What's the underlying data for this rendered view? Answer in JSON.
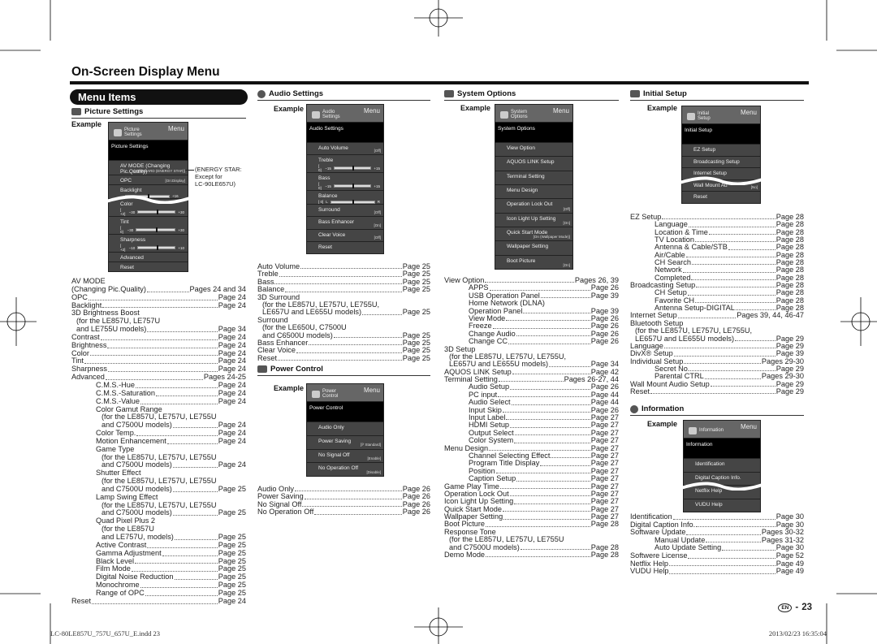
{
  "page_title": "On-Screen Display Menu",
  "menu_items_label": "Menu Items",
  "example_label": "Example",
  "sections": {
    "picture": "Picture Settings",
    "audio": "Audio Settings",
    "power": "Power Control",
    "system": "System Options",
    "initial": "Initial Setup",
    "info": "Information"
  },
  "energy_note": [
    "(ENERGY STAR:",
    "Except for",
    "LC-90LE657U)"
  ],
  "menus": [
    {
      "id": "picture",
      "header": [
        "Picture",
        "Settings"
      ],
      "menu": "Menu",
      "band": "Picture Settings",
      "wave_after": 2,
      "rows": [
        {
          "label": "AV MODE (Changing Pic.Quality)",
          "value": "[STANDARD (ENERGY STAR)]"
        },
        {
          "label": "OPC",
          "value": "[On:Display]"
        },
        {
          "label": "Backlight",
          "slider": {
            "val": "",
            "min": "",
            "max": "+16"
          }
        },
        {
          "label": "Color",
          "slider": {
            "val": "[ +2]",
            "min": "−30",
            "max": "+30"
          }
        },
        {
          "label": "Tint",
          "slider": {
            "val": "[ 0]",
            "min": "−30",
            "max": "+30"
          }
        },
        {
          "label": "Sharpness",
          "slider": {
            "val": "[ +2]",
            "min": "−10",
            "max": "+10"
          }
        },
        {
          "label": "Advanced"
        },
        {
          "label": "Reset"
        }
      ]
    },
    {
      "id": "audio",
      "header": [
        "Audio",
        "Settings"
      ],
      "menu": "Menu",
      "band": "Audio Settings",
      "rows": [
        {
          "label": "Auto Volume",
          "value": "[Off]"
        },
        {
          "label": "Treble",
          "slider": {
            "val": "[ 0]",
            "min": "−15",
            "max": "+15"
          }
        },
        {
          "label": "Bass",
          "slider": {
            "val": "[ 0]",
            "min": "−15",
            "max": "+15"
          }
        },
        {
          "label": "Balance",
          "slider": {
            "val": "[ 0]",
            "min": "L",
            "max": "R"
          }
        },
        {
          "label": "Surround",
          "value": "[Off]"
        },
        {
          "label": "Bass Enhancer",
          "value": "[On]"
        },
        {
          "label": "Clear Voice",
          "value": "[Off]"
        },
        {
          "label": "Reset"
        }
      ]
    },
    {
      "id": "power",
      "header": [
        "Power",
        "Control"
      ],
      "menu": "Menu",
      "band": "Power Control",
      "rows": [
        {
          "label": "Audio Only"
        },
        {
          "label": "Power Saving",
          "value": "[ℙ Standard]"
        },
        {
          "label": "No Signal Off",
          "value": "[Enable]"
        },
        {
          "label": "No Operation Off",
          "value": "[Disable]"
        }
      ]
    },
    {
      "id": "system",
      "header": [
        "System",
        "Options"
      ],
      "menu": "Menu",
      "band": "System Options",
      "rows": [
        {
          "label": "View Option"
        },
        {
          "label": "AQUOS LINK Setup"
        },
        {
          "label": "Terminal Setting"
        },
        {
          "label": "Menu Design"
        },
        {
          "label": "Operation Lock Out",
          "value": "[Off]"
        },
        {
          "label": "Icon Light Up Setting",
          "value": "[On]"
        },
        {
          "label": "Quick Start Mode",
          "value": "[On (Wallpaper Mode)]"
        },
        {
          "label": "Wallpaper Setting"
        },
        {
          "label": "Boot Picture",
          "value": "[On]"
        }
      ]
    },
    {
      "id": "initial",
      "header": [
        "Initial",
        "Setup"
      ],
      "menu": "Menu",
      "band": "Initial Setup",
      "wave_after": 2,
      "rows": [
        {
          "label": "EZ Setup"
        },
        {
          "label": "Broadcasting Setup"
        },
        {
          "label": "Internet Setup"
        },
        {
          "label": "Wall Mount Au",
          "value": "[No]"
        },
        {
          "label": "Reset"
        }
      ]
    },
    {
      "id": "info",
      "header": [
        "Information"
      ],
      "menu": "Menu",
      "band": "Information",
      "wave_after": 1,
      "rows": [
        {
          "label": "Identification"
        },
        {
          "label": "Digital Caption Info."
        },
        {
          "label": "Netflix Help"
        },
        {
          "label": "VUDU Help"
        }
      ]
    }
  ],
  "lists": {
    "picture": [
      {
        "t": "AV MODE",
        "p": "",
        "l": 0
      },
      {
        "t": "(Changing Pic.Quality)",
        "p": "Pages 24 and 34",
        "l": 0
      },
      {
        "t": "OPC",
        "p": "Page 24",
        "l": 0
      },
      {
        "t": "Backlight",
        "p": "Page 24",
        "l": 0
      },
      {
        "t": "3D Brightness Boost",
        "p": "",
        "l": 0
      },
      {
        "t": "(for the LE857U, LE757U",
        "p": "",
        "l": 1
      },
      {
        "t": "and LE755U models)",
        "p": "Page 34",
        "l": 1
      },
      {
        "t": "Contrast",
        "p": "Page 24",
        "l": 0
      },
      {
        "t": "Brightness",
        "p": "Page 24",
        "l": 0
      },
      {
        "t": "Color",
        "p": "Page 24",
        "l": 0
      },
      {
        "t": "Tint",
        "p": "Page 24",
        "l": 0
      },
      {
        "t": "Sharpness",
        "p": "Page 24",
        "l": 0
      },
      {
        "t": "Advanced",
        "p": "Pages 24-25",
        "l": 0
      },
      {
        "t": "C.M.S.-Hue",
        "p": "Page 24",
        "l": 2
      },
      {
        "t": "C.M.S.-Saturation",
        "p": "Page 24",
        "l": 2
      },
      {
        "t": "C.M.S.-Value",
        "p": "Page 24",
        "l": 2
      },
      {
        "t": "Color Gamut Range",
        "p": "",
        "l": 2
      },
      {
        "t": "(for the LE857U, LE757U, LE755U",
        "p": "",
        "l": 3
      },
      {
        "t": "and C7500U models)",
        "p": "Page 24",
        "l": 3
      },
      {
        "t": "Color Temp.",
        "p": "Page 24",
        "l": 2
      },
      {
        "t": "Motion Enhancement",
        "p": "Page 24",
        "l": 2
      },
      {
        "t": "Game Type",
        "p": "",
        "l": 2
      },
      {
        "t": "(for the LE857U, LE757U, LE755U",
        "p": "",
        "l": 3
      },
      {
        "t": "and C7500U models)",
        "p": "Page 24",
        "l": 3
      },
      {
        "t": "Shutter Effect",
        "p": "",
        "l": 2
      },
      {
        "t": "(for the LE857U, LE757U, LE755U",
        "p": "",
        "l": 3
      },
      {
        "t": "and C7500U models)",
        "p": "Page 25",
        "l": 3
      },
      {
        "t": "Lamp Swing Effect",
        "p": "",
        "l": 2
      },
      {
        "t": "(for the LE857U, LE757U, LE755U",
        "p": "",
        "l": 3
      },
      {
        "t": "and C7500U models)",
        "p": "Page 25",
        "l": 3
      },
      {
        "t": "Quad Pixel Plus 2",
        "p": "",
        "l": 2
      },
      {
        "t": "(for the LE857U",
        "p": "",
        "l": 3
      },
      {
        "t": "and LE757U, models)",
        "p": "Page 25",
        "l": 3
      },
      {
        "t": "Active Contrast",
        "p": "Page 25",
        "l": 2
      },
      {
        "t": "Gamma Adjustment",
        "p": "Page 25",
        "l": 2
      },
      {
        "t": "Black Level",
        "p": "Page 25",
        "l": 2
      },
      {
        "t": "Film Mode",
        "p": "Page 25",
        "l": 2
      },
      {
        "t": "Digital Noise Reduction",
        "p": "Page 25",
        "l": 2
      },
      {
        "t": "Monochrome",
        "p": "Page 25",
        "l": 2
      },
      {
        "t": "Range of OPC",
        "p": "Page 25",
        "l": 2
      },
      {
        "t": "Reset",
        "p": "Page 24",
        "l": 0
      }
    ],
    "audio": [
      {
        "t": "Auto Volume",
        "p": "Page 25",
        "l": 0
      },
      {
        "t": "Treble",
        "p": "Page 25",
        "l": 0
      },
      {
        "t": "Bass",
        "p": "Page 25",
        "l": 0
      },
      {
        "t": "Balance",
        "p": "Page 25",
        "l": 0
      },
      {
        "t": "3D Surround",
        "p": "",
        "l": 0
      },
      {
        "t": "(for the LE857U, LE757U, LE755U,",
        "p": "",
        "l": 1
      },
      {
        "t": "LE657U and LE655U models)",
        "p": "Page 25",
        "l": 1
      },
      {
        "t": "Surround",
        "p": "",
        "l": 0
      },
      {
        "t": "(for the LE650U, C7500U",
        "p": "",
        "l": 1
      },
      {
        "t": "and C6500U models)",
        "p": "Page 25",
        "l": 1
      },
      {
        "t": "Bass Enhancer",
        "p": "Page 25",
        "l": 0
      },
      {
        "t": "Clear Voice",
        "p": "Page 25",
        "l": 0
      },
      {
        "t": "Reset",
        "p": "Page 25",
        "l": 0
      }
    ],
    "power": [
      {
        "t": "Audio Only",
        "p": "Page 26",
        "l": 0
      },
      {
        "t": "Power Saving",
        "p": "Page 26",
        "l": 0
      },
      {
        "t": "No Signal Off",
        "p": "Page 26",
        "l": 0
      },
      {
        "t": "No Operation Off",
        "p": "Page 26",
        "l": 0
      }
    ],
    "system": [
      {
        "t": "View Option",
        "p": "Pages 26, 39",
        "l": 0
      },
      {
        "t": "APPS",
        "p": "Page 26",
        "l": 2
      },
      {
        "t": "USB Operation Panel",
        "p": "Page 39",
        "l": 2
      },
      {
        "t": "Home Network (DLNA)",
        "p": "",
        "l": 2
      },
      {
        "t": "Operation Panel",
        "p": "Page 39",
        "l": 2
      },
      {
        "t": "View Mode",
        "p": "Page 26",
        "l": 2
      },
      {
        "t": "Freeze",
        "p": "Page 26",
        "l": 2
      },
      {
        "t": "Change Audio",
        "p": "Page 26",
        "l": 2
      },
      {
        "t": "Change CC",
        "p": "Page 26",
        "l": 2
      },
      {
        "t": "3D Setup",
        "p": "",
        "l": 0
      },
      {
        "t": "(for the LE857U, LE757U, LE755U,",
        "p": "",
        "l": 1
      },
      {
        "t": "LE657U and LE655U models)",
        "p": "Page 34",
        "l": 1
      },
      {
        "t": "AQUOS LINK Setup",
        "p": "Page 42",
        "l": 0
      },
      {
        "t": "Terminal Setting",
        "p": "Pages 26-27, 44",
        "l": 0
      },
      {
        "t": "Audio Setup",
        "p": "Page 26",
        "l": 2
      },
      {
        "t": "PC input",
        "p": "Page 44",
        "l": 2
      },
      {
        "t": "Audio Select",
        "p": "Page 44",
        "l": 2
      },
      {
        "t": "Input Skip",
        "p": "Page 26",
        "l": 2
      },
      {
        "t": "Input Label",
        "p": "Page 27",
        "l": 2
      },
      {
        "t": "HDMI Setup",
        "p": "Page 27",
        "l": 2
      },
      {
        "t": "Output Select",
        "p": "Page 27",
        "l": 2
      },
      {
        "t": "Color System",
        "p": "Page 27",
        "l": 2
      },
      {
        "t": "Menu Design",
        "p": "Page 27",
        "l": 0
      },
      {
        "t": "Channel Selecting Effect",
        "p": "Page 27",
        "l": 2
      },
      {
        "t": "Program Title Display",
        "p": "Page 27",
        "l": 2
      },
      {
        "t": "Position",
        "p": "Page 27",
        "l": 2
      },
      {
        "t": "Caption Setup",
        "p": "Page 27",
        "l": 2
      },
      {
        "t": "Game Play Time",
        "p": "Page 27",
        "l": 0
      },
      {
        "t": "Operation Lock Out",
        "p": "Page 27",
        "l": 0
      },
      {
        "t": "Icon Light Up Setting",
        "p": "Page 27",
        "l": 0
      },
      {
        "t": "Quick Start Mode",
        "p": "Page 27",
        "l": 0
      },
      {
        "t": "Wallpaper Setting",
        "p": "Page 27",
        "l": 0
      },
      {
        "t": "Boot Picture",
        "p": "Page 28",
        "l": 0
      },
      {
        "t": "Response Tone",
        "p": "",
        "l": 0
      },
      {
        "t": "(for the LE857U, LE757U, LE755U",
        "p": "",
        "l": 1
      },
      {
        "t": "and C7500U models)",
        "p": "Page 28",
        "l": 1
      },
      {
        "t": "Demo Mode",
        "p": "Page 28",
        "l": 0
      }
    ],
    "initial": [
      {
        "t": "EZ Setup",
        "p": "Page 28",
        "l": 0
      },
      {
        "t": "Language",
        "p": "Page 28",
        "l": 2
      },
      {
        "t": "Location & Time",
        "p": "Page 28",
        "l": 2
      },
      {
        "t": "TV Location",
        "p": "Page 28",
        "l": 2
      },
      {
        "t": "Antenna & Cable/STB",
        "p": "Page 28",
        "l": 2
      },
      {
        "t": "Air/Cable",
        "p": "Page 28",
        "l": 2
      },
      {
        "t": "CH Search",
        "p": "Page 28",
        "l": 2
      },
      {
        "t": "Network",
        "p": "Page 28",
        "l": 2
      },
      {
        "t": "Completed",
        "p": "Page 28",
        "l": 2
      },
      {
        "t": "Broadcasting Setup",
        "p": "Page 28",
        "l": 0
      },
      {
        "t": "CH Setup",
        "p": "Page 28",
        "l": 2
      },
      {
        "t": "Favorite CH",
        "p": "Page 28",
        "l": 2
      },
      {
        "t": "Antenna Setup-DIGITAL",
        "p": "Page 28",
        "l": 2
      },
      {
        "t": "Internet Setup",
        "p": "Pages 39, 44, 46-47",
        "l": 0
      },
      {
        "t": "Bluetooth Setup",
        "p": "",
        "l": 0
      },
      {
        "t": "(for the LE857U, LE757U, LE755U,",
        "p": "",
        "l": 1
      },
      {
        "t": "LE657U and LE655U models)",
        "p": "Page 29",
        "l": 1
      },
      {
        "t": "Language",
        "p": "Page 29",
        "l": 0
      },
      {
        "t": "DivX® Setup",
        "p": "Page 39",
        "l": 0
      },
      {
        "t": "Individual Setup",
        "p": "Pages 29-30",
        "l": 0
      },
      {
        "t": "Secret No.",
        "p": "Page 29",
        "l": 2
      },
      {
        "t": "Parental CTRL",
        "p": "Pages 29-30",
        "l": 2
      },
      {
        "t": "Wall Mount Audio Setup",
        "p": "Page 29",
        "l": 0
      },
      {
        "t": "Reset",
        "p": "Page 29",
        "l": 0
      }
    ],
    "info": [
      {
        "t": "Identification",
        "p": "Page 30",
        "l": 0
      },
      {
        "t": "Digital Caption Info.",
        "p": "Page 30",
        "l": 0
      },
      {
        "t": "Software Update",
        "p": "Pages 30-32",
        "l": 0
      },
      {
        "t": "Manual Update",
        "p": "Pages 31-32",
        "l": 2
      },
      {
        "t": "Auto Update Setting",
        "p": "Page 30",
        "l": 2
      },
      {
        "t": "Softwere License",
        "p": "Page 52",
        "l": 0
      },
      {
        "t": "Netflix Help",
        "p": "Page 49",
        "l": 0
      },
      {
        "t": "VUDU Help",
        "p": "Page 49",
        "l": 0
      }
    ]
  },
  "page_number": {
    "lang": "EN",
    "sep": "-",
    "num": "23"
  },
  "footer": {
    "file": "LC-80LE857U_757U_657U_E.indd   23",
    "datetime": "2013/02/23   16:35:04"
  }
}
